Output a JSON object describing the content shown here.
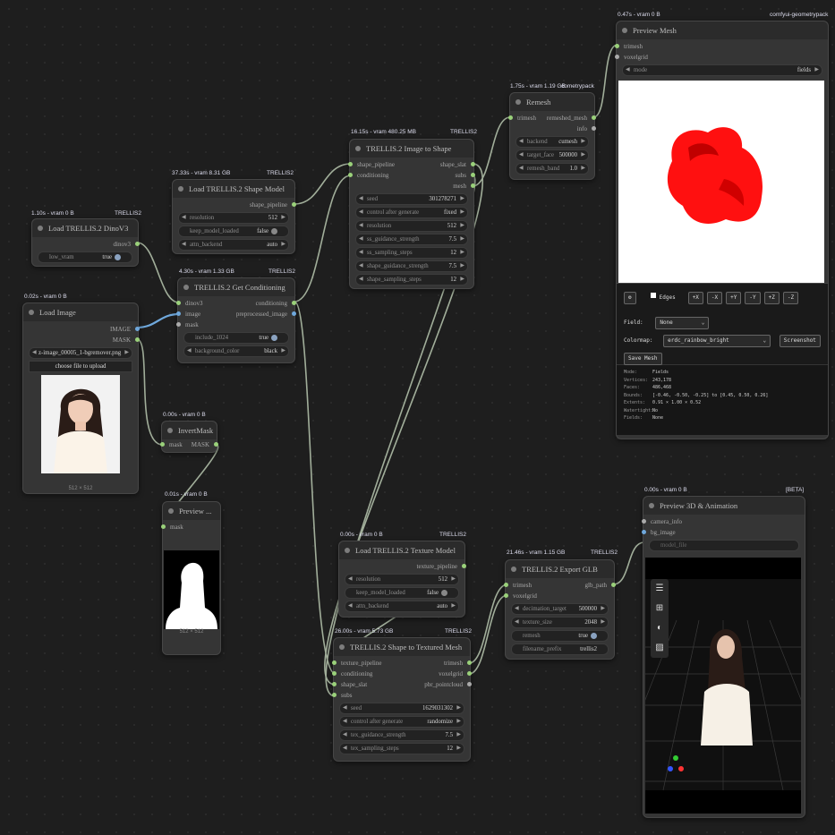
{
  "nodes": {
    "dino": {
      "time": "1.10s - vram 0 B",
      "badge": "TRELLIS2",
      "title": "Load TRELLIS.2 DinoV3",
      "out": "dinov3",
      "w_label": "low_vram",
      "w_value": "true"
    },
    "shape_model": {
      "time": "37.33s - vram 8.31 GB",
      "badge": "TRELLIS2",
      "title": "Load TRELLIS.2 Shape Model",
      "out": "shape_pipeline",
      "widgets": [
        {
          "label": "resolution",
          "value": "512"
        },
        {
          "label": "keep_model_loaded",
          "value": "false"
        },
        {
          "label": "attn_backend",
          "value": "auto"
        }
      ]
    },
    "load_image": {
      "time": "0.02s - vram 0 B",
      "title": "Load Image",
      "out1": "IMAGE",
      "out2": "MASK",
      "file": "z-image_00005_1-bgremover.png",
      "upload": "choose file to upload",
      "size": "512 × 512"
    },
    "get_cond": {
      "time": "4.30s - vram 1.33 GB",
      "badge": "TRELLIS2",
      "title": "TRELLIS.2 Get Conditioning",
      "in": [
        "dinov3",
        "image",
        "mask"
      ],
      "out1": "conditioning",
      "out2": "preprocessed_image",
      "widgets": [
        {
          "label": "include_1024",
          "value": "true"
        },
        {
          "label": "background_color",
          "value": "black"
        }
      ]
    },
    "invert": {
      "time": "0.00s - vram 0 B",
      "title": "InvertMask",
      "in": "mask",
      "out": "MASK"
    },
    "preview_mask": {
      "time": "0.01s - vram 0 B",
      "title": "Preview ...",
      "in": "mask",
      "size": "512 × 512"
    },
    "img2shape": {
      "time": "16.15s - vram 480.25 MB",
      "badge": "TRELLIS2",
      "title": "TRELLIS.2 Image to Shape",
      "in": [
        "shape_pipeline",
        "conditioning"
      ],
      "out": [
        "shape_slat",
        "subs",
        "mesh"
      ],
      "widgets": [
        {
          "label": "seed",
          "value": "301278271"
        },
        {
          "label": "control after generate",
          "value": "fixed"
        },
        {
          "label": "resolution",
          "value": "512"
        },
        {
          "label": "ss_guidance_strength",
          "value": "7.5"
        },
        {
          "label": "ss_sampling_steps",
          "value": "12"
        },
        {
          "label": "shape_guidance_strength",
          "value": "7.5"
        },
        {
          "label": "shape_sampling_steps",
          "value": "12"
        }
      ]
    },
    "remesh": {
      "time": "1.75s - vram 1.19 GB",
      "badge": "cometrypack",
      "title": "Remesh",
      "in": "trimesh",
      "out1": "remeshed_mesh",
      "out2": "info",
      "widgets": [
        {
          "label": "backend",
          "value": "cumesh"
        },
        {
          "label": "target_face",
          "value": "500000"
        },
        {
          "label": "remesh_band",
          "value": "1.0"
        }
      ]
    },
    "preview_mesh": {
      "time": "0.47s - vram 0 B",
      "badge": "comfyui-geometrypack",
      "title": "Preview Mesh",
      "in": [
        "trimesh",
        "voxelgrid"
      ],
      "mode_label": "mode",
      "mode_value": "fields",
      "controls": [
        "Edges",
        "+X",
        "-X",
        "+Y",
        "-Y",
        "+Z",
        "-Z"
      ],
      "field_label": "Field:",
      "field_value": "None",
      "cmap_label": "Colormap:",
      "cmap_value": "erdc_rainbow_bright",
      "screenshot": "Screenshot",
      "save": "Save Mesh",
      "stats": [
        {
          "k": "Mode:",
          "v": "Fields"
        },
        {
          "k": "Vertices:",
          "v": "243,178"
        },
        {
          "k": "Faces:",
          "v": "486,468"
        },
        {
          "k": "Bounds:",
          "v": "[-0.46, -0.50, -0.25] to [0.45, 0.50, 0.26]"
        },
        {
          "k": "Extents:",
          "v": "0.91 × 1.00 × 0.52"
        },
        {
          "k": "Watertight:",
          "v": "No"
        },
        {
          "k": "Fields:",
          "v": "None"
        }
      ]
    },
    "tex_model": {
      "time": "0.00s - vram 0 B",
      "badge": "TRELLIS2",
      "title": "Load TRELLIS.2 Texture Model",
      "out": "texture_pipeline",
      "widgets": [
        {
          "label": "resolution",
          "value": "512"
        },
        {
          "label": "keep_model_loaded",
          "value": "false"
        },
        {
          "label": "attn_backend",
          "value": "auto"
        }
      ]
    },
    "textured": {
      "time": "26.00s - vram 5.73 GB",
      "badge": "TRELLIS2",
      "title": "TRELLIS.2 Shape to Textured Mesh",
      "in": [
        "texture_pipeline",
        "conditioning",
        "shape_slat",
        "subs"
      ],
      "out": [
        "trimesh",
        "voxelgrid",
        "pbr_pointcloud"
      ],
      "widgets": [
        {
          "label": "seed",
          "value": "1629031302"
        },
        {
          "label": "control after generate",
          "value": "randomize"
        },
        {
          "label": "tex_guidance_strength",
          "value": "7.5"
        },
        {
          "label": "tex_sampling_steps",
          "value": "12"
        }
      ]
    },
    "export": {
      "time": "21.46s - vram 1.15 GB",
      "badge": "TRELLIS2",
      "title": "TRELLIS.2 Export GLB",
      "in": [
        "trimesh",
        "voxelgrid"
      ],
      "out": "glb_path",
      "widgets": [
        {
          "label": "decimation_target",
          "value": "500000"
        },
        {
          "label": "texture_size",
          "value": "2048"
        },
        {
          "label": "remesh",
          "value": "true"
        },
        {
          "label": "filename_prefix",
          "value": "trellis2"
        }
      ]
    },
    "preview3d": {
      "time": "0.00s - vram 0 B",
      "badge": "[BETA]",
      "title": "Preview 3D & Animation",
      "in": [
        "camera_info",
        "bg_image"
      ],
      "model_file": "model_file"
    }
  }
}
